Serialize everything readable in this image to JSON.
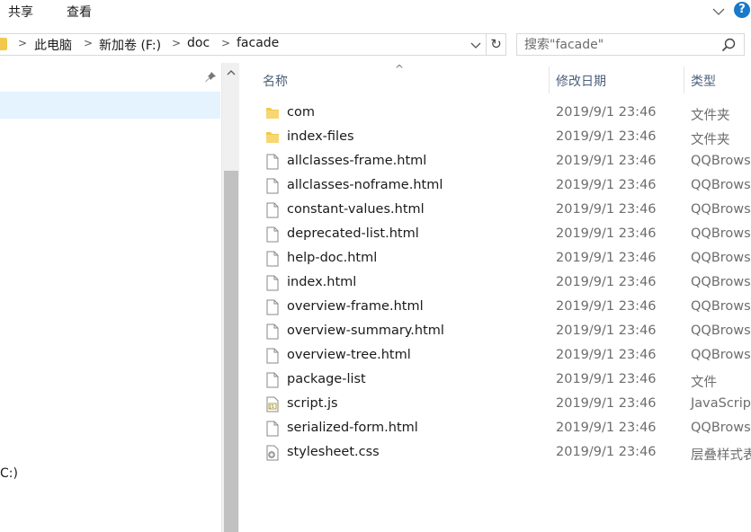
{
  "ribbon": {
    "tabs": [
      "共享",
      "查看"
    ]
  },
  "address": {
    "crumbs": [
      "此电脑",
      "新加卷 (F:)",
      "doc",
      "facade"
    ]
  },
  "search": {
    "placeholder": "搜索\"facade\""
  },
  "nav": {
    "drive_fragment": "C:)"
  },
  "columns": {
    "name": "名称",
    "date": "修改日期",
    "type": "类型"
  },
  "files": [
    {
      "name": "com",
      "date": "2019/9/1 23:46",
      "type": "文件夹",
      "icon": "folder-icon"
    },
    {
      "name": "index-files",
      "date": "2019/9/1 23:46",
      "type": "文件夹",
      "icon": "folder-icon"
    },
    {
      "name": "allclasses-frame.html",
      "date": "2019/9/1 23:46",
      "type": "QQBrows",
      "icon": "file-icon"
    },
    {
      "name": "allclasses-noframe.html",
      "date": "2019/9/1 23:46",
      "type": "QQBrows",
      "icon": "file-icon"
    },
    {
      "name": "constant-values.html",
      "date": "2019/9/1 23:46",
      "type": "QQBrows",
      "icon": "file-icon"
    },
    {
      "name": "deprecated-list.html",
      "date": "2019/9/1 23:46",
      "type": "QQBrows",
      "icon": "file-icon"
    },
    {
      "name": "help-doc.html",
      "date": "2019/9/1 23:46",
      "type": "QQBrows",
      "icon": "file-icon"
    },
    {
      "name": "index.html",
      "date": "2019/9/1 23:46",
      "type": "QQBrows",
      "icon": "file-icon"
    },
    {
      "name": "overview-frame.html",
      "date": "2019/9/1 23:46",
      "type": "QQBrows",
      "icon": "file-icon"
    },
    {
      "name": "overview-summary.html",
      "date": "2019/9/1 23:46",
      "type": "QQBrows",
      "icon": "file-icon"
    },
    {
      "name": "overview-tree.html",
      "date": "2019/9/1 23:46",
      "type": "QQBrows",
      "icon": "file-icon"
    },
    {
      "name": "package-list",
      "date": "2019/9/1 23:46",
      "type": "文件",
      "icon": "file-icon"
    },
    {
      "name": "script.js",
      "date": "2019/9/1 23:46",
      "type": "JavaScrip",
      "icon": "js-file-icon"
    },
    {
      "name": "serialized-form.html",
      "date": "2019/9/1 23:46",
      "type": "QQBrows",
      "icon": "file-icon"
    },
    {
      "name": "stylesheet.css",
      "date": "2019/9/1 23:46",
      "type": "层叠样式表",
      "icon": "css-file-icon"
    }
  ],
  "colors": {
    "folder": "#f2c94c",
    "selection": "#e5f3ff",
    "header_text": "#4c607a",
    "help_badge": "#1979ca"
  }
}
